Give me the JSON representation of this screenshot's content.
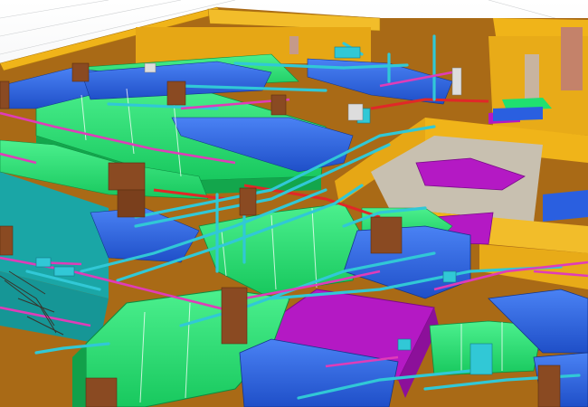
{
  "viewport": {
    "palette": {
      "floor": "#a96a16",
      "wall": "#f0b419",
      "duct_green": "#1fe070",
      "duct_blue": "#2a5fe0",
      "duct_magenta": "#b419c4",
      "pipe_cyan": "#31c8d6",
      "pipe_pink": "#e03cb8",
      "pipe_red": "#e02828",
      "column": "#8a4a22",
      "slab_teal": "#1aa6a6",
      "grey_wall": "#c8c0b0"
    }
  }
}
